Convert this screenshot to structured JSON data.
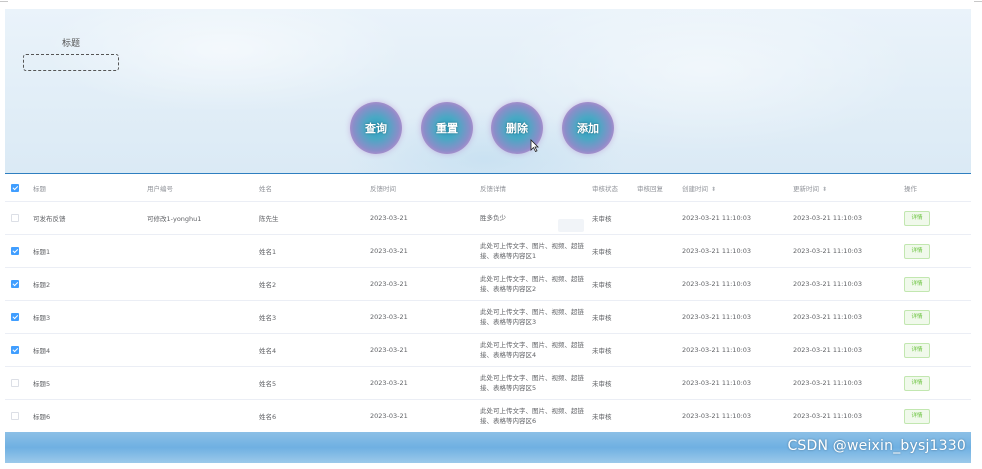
{
  "search": {
    "label": "标题",
    "value": ""
  },
  "buttons": {
    "query": "查询",
    "reset": "重置",
    "delete": "删除",
    "add": "添加"
  },
  "table": {
    "headers": [
      "标题",
      "用户编号",
      "姓名",
      "反馈时间",
      "反馈详情",
      "审核状态",
      "审核回复",
      "创建时间",
      "更新时间",
      "操作"
    ],
    "rows": [
      {
        "checked": false,
        "title": "可发布反馈",
        "user": "可修改1-yonghu1",
        "name": "陈先生",
        "time": "2023-03-21",
        "detail": "胜多负少",
        "status": "未审核",
        "reply": "",
        "created": "2023-03-21 11:10:03",
        "updated": "2023-03-21 11:10:03",
        "action": "详情"
      },
      {
        "checked": true,
        "title": "标题1",
        "user": "",
        "name": "姓名1",
        "time": "2023-03-21",
        "detail": "此处可上传文字、图片、视频、超链接、表格等内容区1",
        "status": "未审核",
        "reply": "",
        "created": "2023-03-21 11:10:03",
        "updated": "2023-03-21 11:10:03",
        "action": "详情"
      },
      {
        "checked": true,
        "title": "标题2",
        "user": "",
        "name": "姓名2",
        "time": "2023-03-21",
        "detail": "此处可上传文字、图片、视频、超链接、表格等内容区2",
        "status": "未审核",
        "reply": "",
        "created": "2023-03-21 11:10:03",
        "updated": "2023-03-21 11:10:03",
        "action": "详情"
      },
      {
        "checked": true,
        "title": "标题3",
        "user": "",
        "name": "姓名3",
        "time": "2023-03-21",
        "detail": "此处可上传文字、图片、视频、超链接、表格等内容区3",
        "status": "未审核",
        "reply": "",
        "created": "2023-03-21 11:10:03",
        "updated": "2023-03-21 11:10:03",
        "action": "详情"
      },
      {
        "checked": true,
        "title": "标题4",
        "user": "",
        "name": "姓名4",
        "time": "2023-03-21",
        "detail": "此处可上传文字、图片、视频、超链接、表格等内容区4",
        "status": "未审核",
        "reply": "",
        "created": "2023-03-21 11:10:03",
        "updated": "2023-03-21 11:10:03",
        "action": "详情"
      },
      {
        "checked": false,
        "title": "标题5",
        "user": "",
        "name": "姓名5",
        "time": "2023-03-21",
        "detail": "此处可上传文字、图片、视频、超链接、表格等内容区5",
        "status": "未审核",
        "reply": "",
        "created": "2023-03-21 11:10:03",
        "updated": "2023-03-21 11:10:03",
        "action": "详情"
      },
      {
        "checked": false,
        "title": "标题6",
        "user": "",
        "name": "姓名6",
        "time": "2023-03-21",
        "detail": "此处可上传文字、图片、视频、超链接、表格等内容区6",
        "status": "未审核",
        "reply": "",
        "created": "2023-03-21 11:10:03",
        "updated": "2023-03-21 11:10:03",
        "action": "详情"
      }
    ]
  },
  "watermark": "CSDN @weixin_bysj1330",
  "colors": {
    "accent": "#409eff",
    "success": "#67c23a",
    "border_top": "#2f7fc0"
  }
}
